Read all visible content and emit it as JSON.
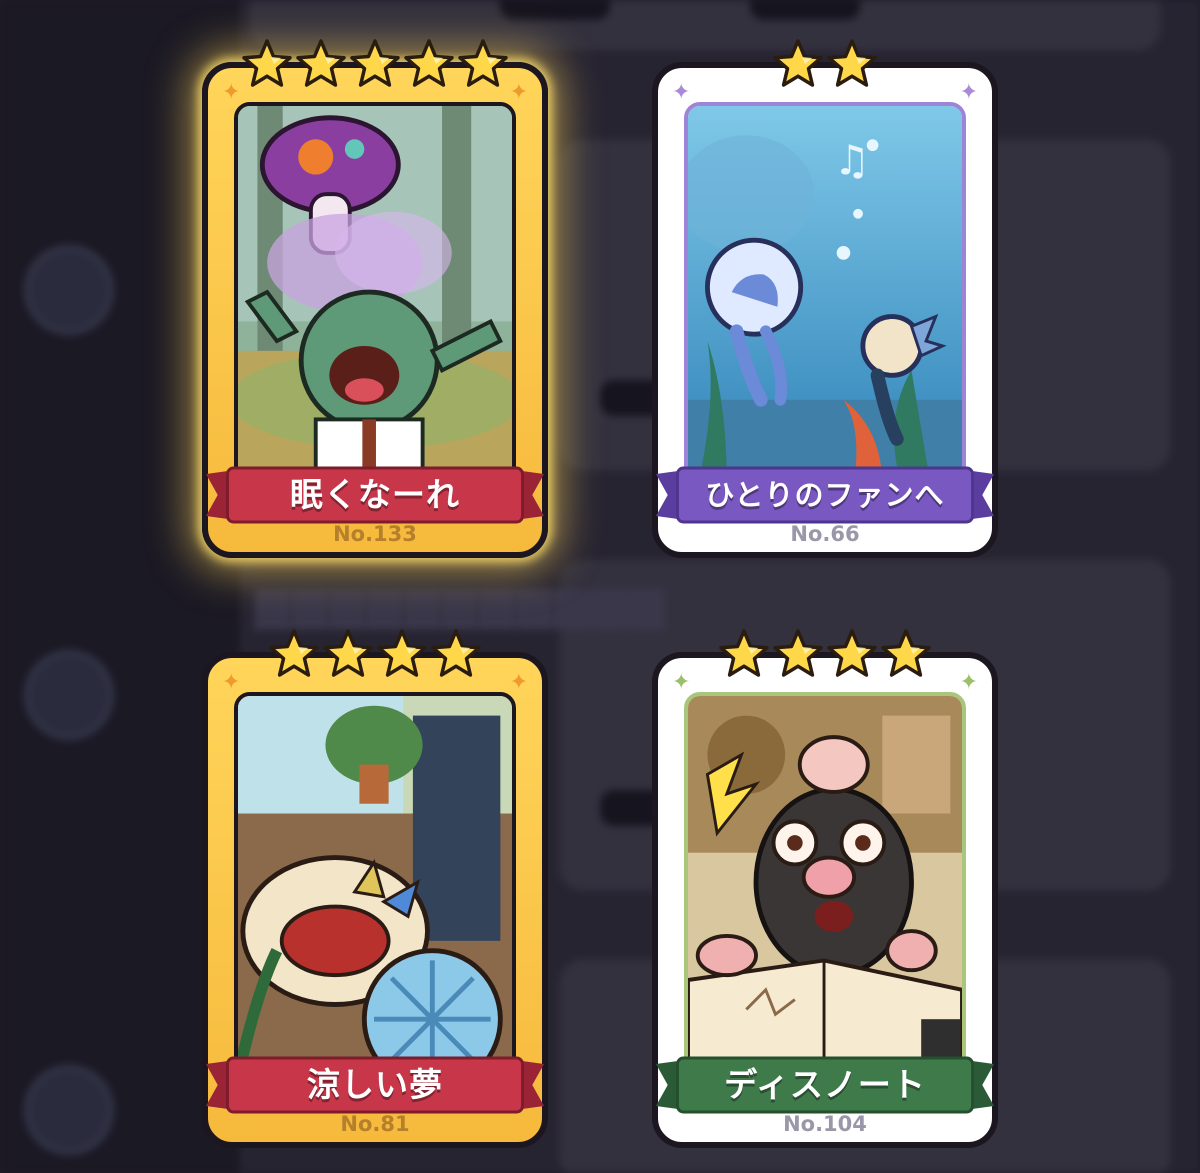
{
  "colors": {
    "gold_card": "#f6b93c",
    "white_card": "#ffffff",
    "red_ribbon": "#c8364a",
    "purple_ribbon": "#7a58c2",
    "green_ribbon": "#3f7a4a",
    "star": "#ffd84a"
  },
  "cards": [
    {
      "title": "眠くなーれ",
      "number": "No.133",
      "stars": 5,
      "style": "gold",
      "ribbon": "red",
      "highlighted": true
    },
    {
      "title": "ひとりのファンへ",
      "number": "No.66",
      "stars": 2,
      "style": "white",
      "ribbon": "purple",
      "highlighted": false
    },
    {
      "title": "涼しい夢",
      "number": "No.81",
      "stars": 4,
      "style": "gold",
      "ribbon": "red",
      "highlighted": false
    },
    {
      "title": "ディスノート",
      "number": "No.104",
      "stars": 4,
      "style": "white",
      "ribbon": "green",
      "highlighted": false
    }
  ]
}
